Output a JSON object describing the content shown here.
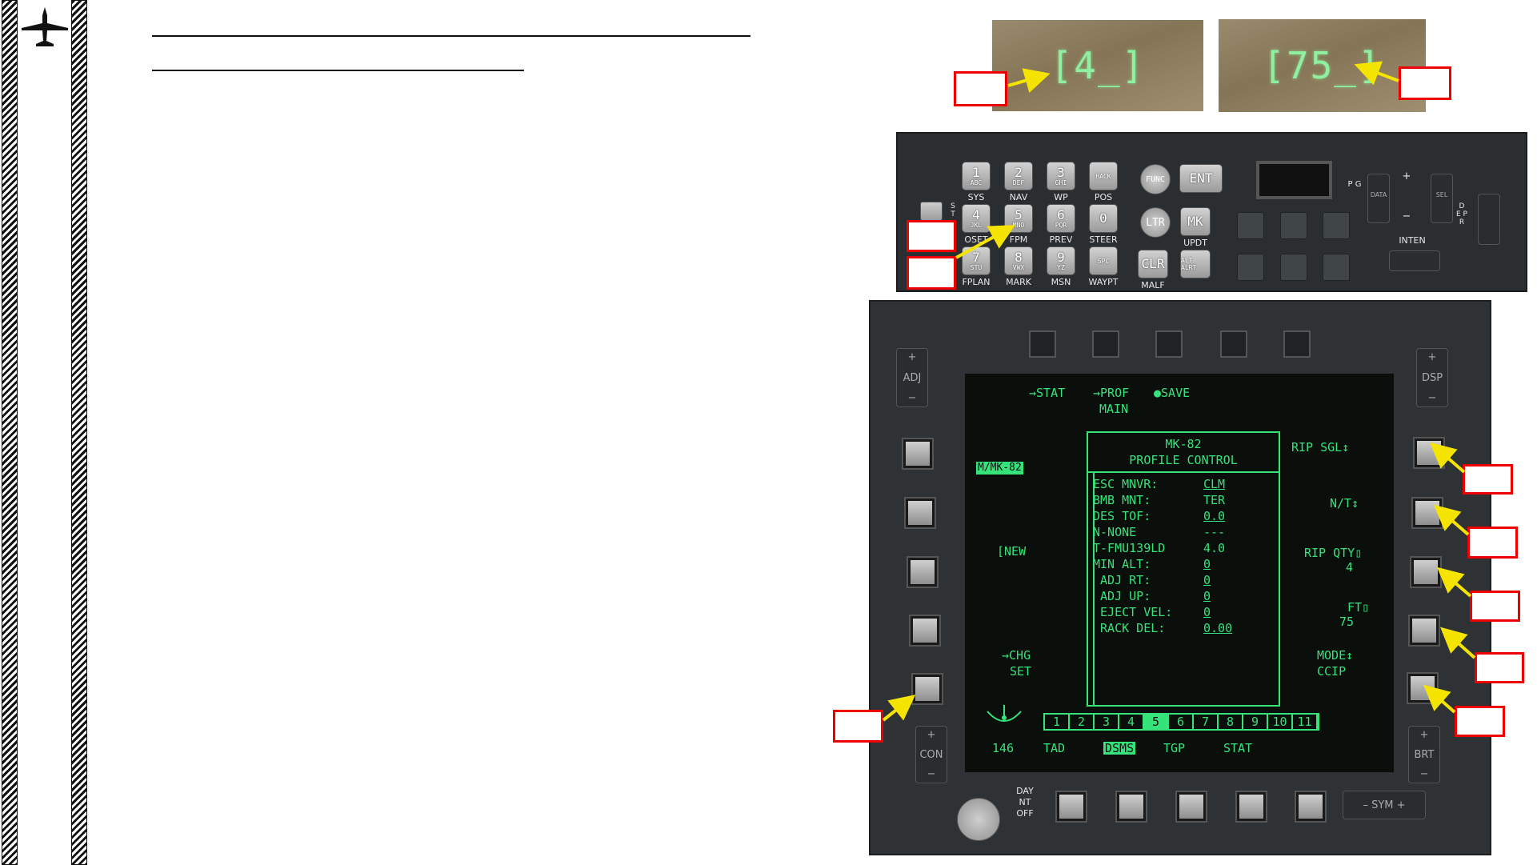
{
  "page": {
    "aircraft_icon": "aircraft-silhouette-icon"
  },
  "hud_closeups": {
    "left_display": "[4_]",
    "right_display": "[75_]"
  },
  "cdu": {
    "rows": [
      [
        {
          "num": "1",
          "sub": "ABC",
          "label": "SYS"
        },
        {
          "num": "2",
          "sub": "DEF",
          "label": "NAV"
        },
        {
          "num": "3",
          "sub": "GHI",
          "label": "WP"
        },
        {
          "num": "HACK",
          "sub": "",
          "label": "POS"
        }
      ],
      [
        {
          "num": "4",
          "sub": "JKL",
          "label": "OSET"
        },
        {
          "num": "5",
          "sub": "MNO",
          "label": "FPM"
        },
        {
          "num": "6",
          "sub": "PQR",
          "label": "PREV"
        },
        {
          "num": "0",
          "sub": "",
          "label": "STEER"
        }
      ],
      [
        {
          "num": "7",
          "sub": "STU",
          "label": "FPLAN"
        },
        {
          "num": "8",
          "sub": "VWX",
          "label": "MARK"
        },
        {
          "num": "9",
          "sub": "YZ",
          "label": "MSN"
        },
        {
          "num": "SPC",
          "sub": "",
          "label": "WAYPT"
        }
      ]
    ],
    "func": "FUNC",
    "ltr": "LTR",
    "clr": "CLR",
    "clr_label": "MALF",
    "ent": "ENT",
    "mk": "MK",
    "mk_label": "UPDT",
    "altalrt": "ALT ALRT",
    "inten": "INTEN",
    "pg": "P G",
    "data": "DATA",
    "sel": "SEL",
    "depr": "D E P R",
    "st": "S T",
    "plus": "+",
    "minus": "−"
  },
  "mfcd": {
    "top_labels": {
      "stat": "→STAT",
      "prof": "→PROF",
      "main": "MAIN",
      "save": "●SAVE"
    },
    "left_labels": {
      "weapon": "M/MK-82",
      "new": "[NEW",
      "chg": "→CHG",
      "set": "SET"
    },
    "right_labels": {
      "rip": "RIP SGL↕",
      "nt": "N/T↕",
      "ripqty": "RIP QTY▯",
      "ripqty_val": "4",
      "ft": "FT▯",
      "ft_val": "75",
      "mode": "MODE↕",
      "mode_val": "CCIP"
    },
    "panel": {
      "title1": "MK-82",
      "title2": "PROFILE CONTROL",
      "rows": [
        {
          "k": "ESC MNVR:",
          "v": "CLM",
          "u": true
        },
        {
          "k": "BMB MNT:",
          "v": "TER",
          "u": false
        },
        {
          "k": "DES TOF:",
          "v": "0.0",
          "u": true
        },
        {
          "k": "N-NONE",
          "v": "---",
          "u": false
        },
        {
          "k": "T-FMU139LD",
          "v": "4.0",
          "u": false
        },
        {
          "k": "MIN ALT:",
          "v": "0",
          "u": true
        },
        {
          "k": " ADJ RT:",
          "v": "0",
          "u": true
        },
        {
          "k": " ADJ UP:",
          "v": "0",
          "u": true
        },
        {
          "k": " EJECT VEL:",
          "v": "0",
          "u": true
        },
        {
          "k": " RACK DEL:",
          "v": "0.00",
          "u": true
        }
      ],
      "stations": [
        "1",
        "2",
        "3",
        "4",
        "5",
        "6",
        "7",
        "8",
        "9",
        "10",
        "11"
      ],
      "selected_station": "5"
    },
    "bottom_labels": [
      "TAD",
      "DSMS",
      "TGP",
      "STAT"
    ],
    "selected_bottom": "DSMS",
    "heading": "146",
    "adj": "ADJ",
    "dsp": "DSP",
    "con": "CON",
    "brt": "BRT",
    "sym": "– SYM +",
    "daynt": "DAY NT OFF"
  },
  "colors": {
    "mfcd_green": "#36e27a",
    "callout_red": "#e00000",
    "arrow_yellow": "#f5e400"
  }
}
